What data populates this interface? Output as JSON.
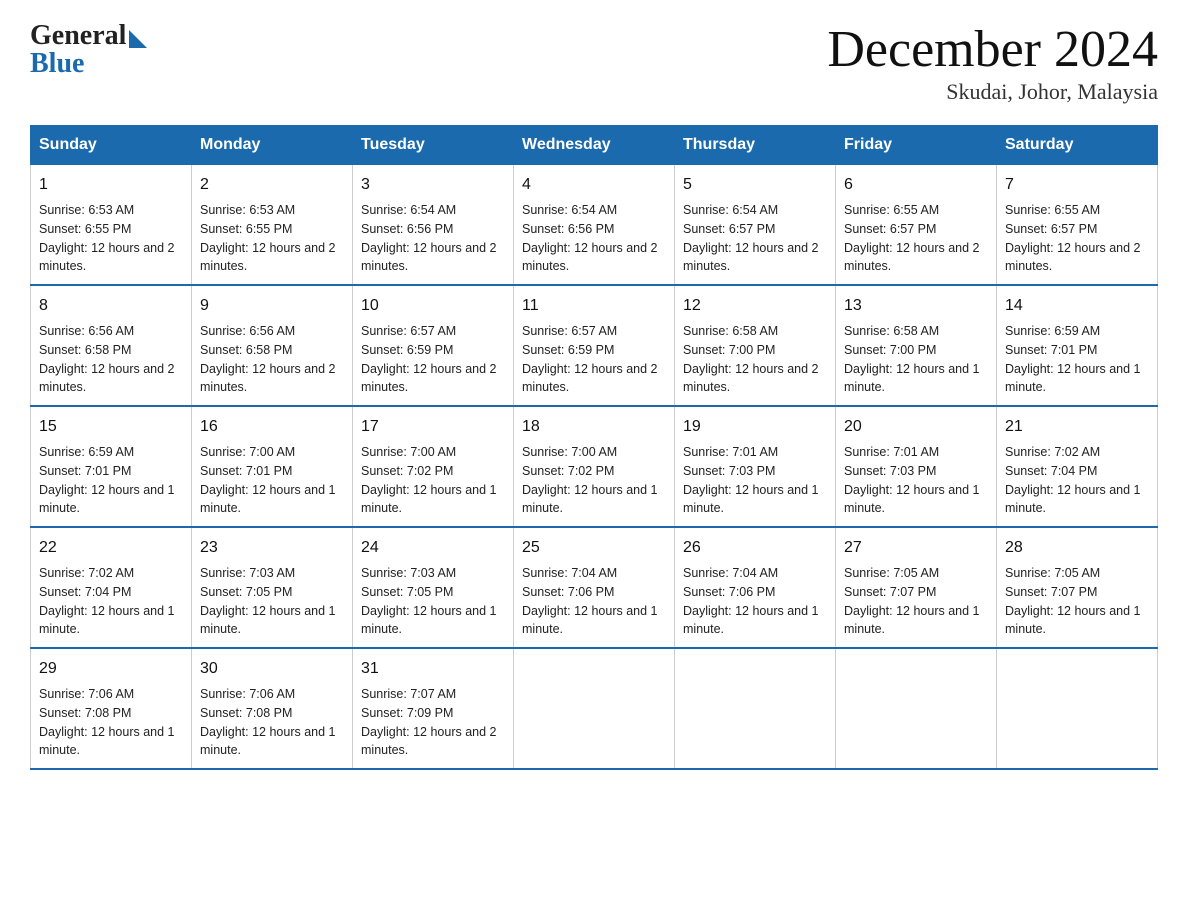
{
  "logo": {
    "general": "General",
    "blue": "Blue"
  },
  "title": "December 2024",
  "location": "Skudai, Johor, Malaysia",
  "days_of_week": [
    "Sunday",
    "Monday",
    "Tuesday",
    "Wednesday",
    "Thursday",
    "Friday",
    "Saturday"
  ],
  "weeks": [
    [
      {
        "day": "1",
        "sunrise": "6:53 AM",
        "sunset": "6:55 PM",
        "daylight": "12 hours and 2 minutes."
      },
      {
        "day": "2",
        "sunrise": "6:53 AM",
        "sunset": "6:55 PM",
        "daylight": "12 hours and 2 minutes."
      },
      {
        "day": "3",
        "sunrise": "6:54 AM",
        "sunset": "6:56 PM",
        "daylight": "12 hours and 2 minutes."
      },
      {
        "day": "4",
        "sunrise": "6:54 AM",
        "sunset": "6:56 PM",
        "daylight": "12 hours and 2 minutes."
      },
      {
        "day": "5",
        "sunrise": "6:54 AM",
        "sunset": "6:57 PM",
        "daylight": "12 hours and 2 minutes."
      },
      {
        "day": "6",
        "sunrise": "6:55 AM",
        "sunset": "6:57 PM",
        "daylight": "12 hours and 2 minutes."
      },
      {
        "day": "7",
        "sunrise": "6:55 AM",
        "sunset": "6:57 PM",
        "daylight": "12 hours and 2 minutes."
      }
    ],
    [
      {
        "day": "8",
        "sunrise": "6:56 AM",
        "sunset": "6:58 PM",
        "daylight": "12 hours and 2 minutes."
      },
      {
        "day": "9",
        "sunrise": "6:56 AM",
        "sunset": "6:58 PM",
        "daylight": "12 hours and 2 minutes."
      },
      {
        "day": "10",
        "sunrise": "6:57 AM",
        "sunset": "6:59 PM",
        "daylight": "12 hours and 2 minutes."
      },
      {
        "day": "11",
        "sunrise": "6:57 AM",
        "sunset": "6:59 PM",
        "daylight": "12 hours and 2 minutes."
      },
      {
        "day": "12",
        "sunrise": "6:58 AM",
        "sunset": "7:00 PM",
        "daylight": "12 hours and 2 minutes."
      },
      {
        "day": "13",
        "sunrise": "6:58 AM",
        "sunset": "7:00 PM",
        "daylight": "12 hours and 1 minute."
      },
      {
        "day": "14",
        "sunrise": "6:59 AM",
        "sunset": "7:01 PM",
        "daylight": "12 hours and 1 minute."
      }
    ],
    [
      {
        "day": "15",
        "sunrise": "6:59 AM",
        "sunset": "7:01 PM",
        "daylight": "12 hours and 1 minute."
      },
      {
        "day": "16",
        "sunrise": "7:00 AM",
        "sunset": "7:01 PM",
        "daylight": "12 hours and 1 minute."
      },
      {
        "day": "17",
        "sunrise": "7:00 AM",
        "sunset": "7:02 PM",
        "daylight": "12 hours and 1 minute."
      },
      {
        "day": "18",
        "sunrise": "7:00 AM",
        "sunset": "7:02 PM",
        "daylight": "12 hours and 1 minute."
      },
      {
        "day": "19",
        "sunrise": "7:01 AM",
        "sunset": "7:03 PM",
        "daylight": "12 hours and 1 minute."
      },
      {
        "day": "20",
        "sunrise": "7:01 AM",
        "sunset": "7:03 PM",
        "daylight": "12 hours and 1 minute."
      },
      {
        "day": "21",
        "sunrise": "7:02 AM",
        "sunset": "7:04 PM",
        "daylight": "12 hours and 1 minute."
      }
    ],
    [
      {
        "day": "22",
        "sunrise": "7:02 AM",
        "sunset": "7:04 PM",
        "daylight": "12 hours and 1 minute."
      },
      {
        "day": "23",
        "sunrise": "7:03 AM",
        "sunset": "7:05 PM",
        "daylight": "12 hours and 1 minute."
      },
      {
        "day": "24",
        "sunrise": "7:03 AM",
        "sunset": "7:05 PM",
        "daylight": "12 hours and 1 minute."
      },
      {
        "day": "25",
        "sunrise": "7:04 AM",
        "sunset": "7:06 PM",
        "daylight": "12 hours and 1 minute."
      },
      {
        "day": "26",
        "sunrise": "7:04 AM",
        "sunset": "7:06 PM",
        "daylight": "12 hours and 1 minute."
      },
      {
        "day": "27",
        "sunrise": "7:05 AM",
        "sunset": "7:07 PM",
        "daylight": "12 hours and 1 minute."
      },
      {
        "day": "28",
        "sunrise": "7:05 AM",
        "sunset": "7:07 PM",
        "daylight": "12 hours and 1 minute."
      }
    ],
    [
      {
        "day": "29",
        "sunrise": "7:06 AM",
        "sunset": "7:08 PM",
        "daylight": "12 hours and 1 minute."
      },
      {
        "day": "30",
        "sunrise": "7:06 AM",
        "sunset": "7:08 PM",
        "daylight": "12 hours and 1 minute."
      },
      {
        "day": "31",
        "sunrise": "7:07 AM",
        "sunset": "7:09 PM",
        "daylight": "12 hours and 2 minutes."
      },
      null,
      null,
      null,
      null
    ]
  ]
}
